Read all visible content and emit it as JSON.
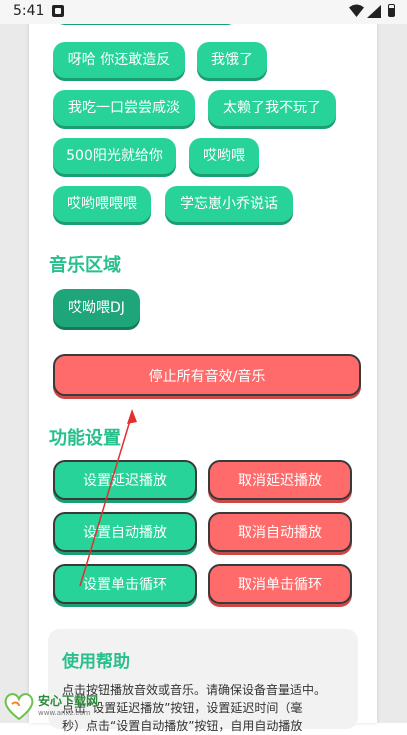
{
  "status_bar": {
    "time": "5:41"
  },
  "sound_buttons": [
    {
      "label": "呀哈 你还敢造反"
    },
    {
      "label": "我饿了"
    },
    {
      "label": "我吃一口尝尝咸淡"
    },
    {
      "label": "太赖了我不玩了"
    },
    {
      "label": "500阳光就给你"
    },
    {
      "label": "哎哟喂"
    },
    {
      "label": "哎哟喂喂喂"
    },
    {
      "label": "学忘崽小乔说话"
    }
  ],
  "music_section": {
    "title": "音乐区域",
    "buttons": [
      {
        "label": "哎呦喂DJ"
      }
    ]
  },
  "stop_button": "停止所有音效/音乐",
  "function_section": {
    "title": "功能设置",
    "buttons": {
      "set_delay": "设置延迟播放",
      "cancel_delay": "取消延迟播放",
      "set_auto": "设置自动播放",
      "cancel_auto": "取消自动播放",
      "set_loop": "设置单击循环",
      "cancel_loop": "取消单击循环"
    }
  },
  "help": {
    "title": "使用帮助",
    "text_line1": "点击按钮播放音效或音乐。请确保设备音量适中。",
    "text_line2": "点击“设置延迟播放”按钮，设置延迟时间（毫",
    "text_line3": "秒）点击“设置自动播放”按钮，自用自动播放"
  },
  "watermark": {
    "brand": "安心下载网",
    "url": "www.anxz.com"
  },
  "colors": {
    "green": "#27d398",
    "dark_green": "#1fa57a",
    "red": "#ff6b6b",
    "section_title": "#27c08d"
  }
}
